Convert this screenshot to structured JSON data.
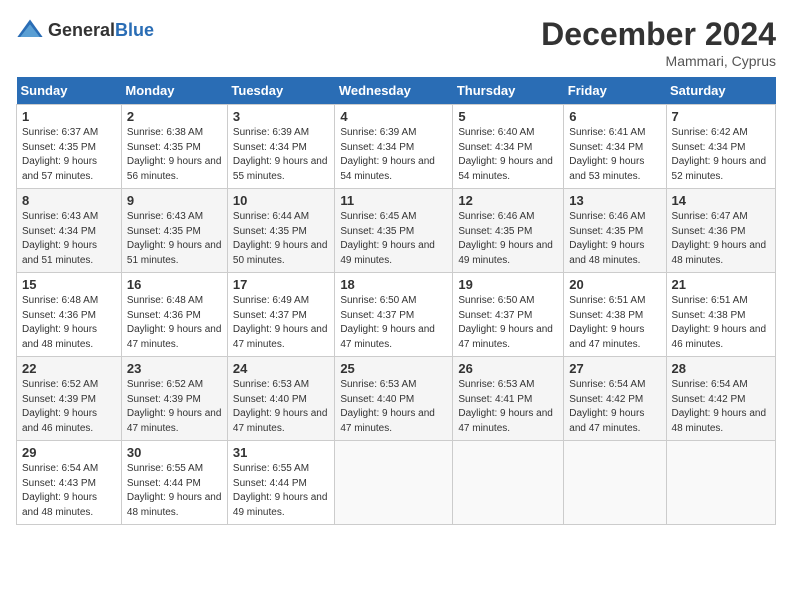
{
  "header": {
    "logo_general": "General",
    "logo_blue": "Blue",
    "month_title": "December 2024",
    "location": "Mammari, Cyprus"
  },
  "days_of_week": [
    "Sunday",
    "Monday",
    "Tuesday",
    "Wednesday",
    "Thursday",
    "Friday",
    "Saturday"
  ],
  "weeks": [
    [
      {
        "day": "1",
        "sunrise": "6:37 AM",
        "sunset": "4:35 PM",
        "daylight": "9 hours and 57 minutes."
      },
      {
        "day": "2",
        "sunrise": "6:38 AM",
        "sunset": "4:35 PM",
        "daylight": "9 hours and 56 minutes."
      },
      {
        "day": "3",
        "sunrise": "6:39 AM",
        "sunset": "4:34 PM",
        "daylight": "9 hours and 55 minutes."
      },
      {
        "day": "4",
        "sunrise": "6:39 AM",
        "sunset": "4:34 PM",
        "daylight": "9 hours and 54 minutes."
      },
      {
        "day": "5",
        "sunrise": "6:40 AM",
        "sunset": "4:34 PM",
        "daylight": "9 hours and 54 minutes."
      },
      {
        "day": "6",
        "sunrise": "6:41 AM",
        "sunset": "4:34 PM",
        "daylight": "9 hours and 53 minutes."
      },
      {
        "day": "7",
        "sunrise": "6:42 AM",
        "sunset": "4:34 PM",
        "daylight": "9 hours and 52 minutes."
      }
    ],
    [
      {
        "day": "8",
        "sunrise": "6:43 AM",
        "sunset": "4:34 PM",
        "daylight": "9 hours and 51 minutes."
      },
      {
        "day": "9",
        "sunrise": "6:43 AM",
        "sunset": "4:35 PM",
        "daylight": "9 hours and 51 minutes."
      },
      {
        "day": "10",
        "sunrise": "6:44 AM",
        "sunset": "4:35 PM",
        "daylight": "9 hours and 50 minutes."
      },
      {
        "day": "11",
        "sunrise": "6:45 AM",
        "sunset": "4:35 PM",
        "daylight": "9 hours and 49 minutes."
      },
      {
        "day": "12",
        "sunrise": "6:46 AM",
        "sunset": "4:35 PM",
        "daylight": "9 hours and 49 minutes."
      },
      {
        "day": "13",
        "sunrise": "6:46 AM",
        "sunset": "4:35 PM",
        "daylight": "9 hours and 48 minutes."
      },
      {
        "day": "14",
        "sunrise": "6:47 AM",
        "sunset": "4:36 PM",
        "daylight": "9 hours and 48 minutes."
      }
    ],
    [
      {
        "day": "15",
        "sunrise": "6:48 AM",
        "sunset": "4:36 PM",
        "daylight": "9 hours and 48 minutes."
      },
      {
        "day": "16",
        "sunrise": "6:48 AM",
        "sunset": "4:36 PM",
        "daylight": "9 hours and 47 minutes."
      },
      {
        "day": "17",
        "sunrise": "6:49 AM",
        "sunset": "4:37 PM",
        "daylight": "9 hours and 47 minutes."
      },
      {
        "day": "18",
        "sunrise": "6:50 AM",
        "sunset": "4:37 PM",
        "daylight": "9 hours and 47 minutes."
      },
      {
        "day": "19",
        "sunrise": "6:50 AM",
        "sunset": "4:37 PM",
        "daylight": "9 hours and 47 minutes."
      },
      {
        "day": "20",
        "sunrise": "6:51 AM",
        "sunset": "4:38 PM",
        "daylight": "9 hours and 47 minutes."
      },
      {
        "day": "21",
        "sunrise": "6:51 AM",
        "sunset": "4:38 PM",
        "daylight": "9 hours and 46 minutes."
      }
    ],
    [
      {
        "day": "22",
        "sunrise": "6:52 AM",
        "sunset": "4:39 PM",
        "daylight": "9 hours and 46 minutes."
      },
      {
        "day": "23",
        "sunrise": "6:52 AM",
        "sunset": "4:39 PM",
        "daylight": "9 hours and 47 minutes."
      },
      {
        "day": "24",
        "sunrise": "6:53 AM",
        "sunset": "4:40 PM",
        "daylight": "9 hours and 47 minutes."
      },
      {
        "day": "25",
        "sunrise": "6:53 AM",
        "sunset": "4:40 PM",
        "daylight": "9 hours and 47 minutes."
      },
      {
        "day": "26",
        "sunrise": "6:53 AM",
        "sunset": "4:41 PM",
        "daylight": "9 hours and 47 minutes."
      },
      {
        "day": "27",
        "sunrise": "6:54 AM",
        "sunset": "4:42 PM",
        "daylight": "9 hours and 47 minutes."
      },
      {
        "day": "28",
        "sunrise": "6:54 AM",
        "sunset": "4:42 PM",
        "daylight": "9 hours and 48 minutes."
      }
    ],
    [
      {
        "day": "29",
        "sunrise": "6:54 AM",
        "sunset": "4:43 PM",
        "daylight": "9 hours and 48 minutes."
      },
      {
        "day": "30",
        "sunrise": "6:55 AM",
        "sunset": "4:44 PM",
        "daylight": "9 hours and 48 minutes."
      },
      {
        "day": "31",
        "sunrise": "6:55 AM",
        "sunset": "4:44 PM",
        "daylight": "9 hours and 49 minutes."
      },
      null,
      null,
      null,
      null
    ]
  ]
}
